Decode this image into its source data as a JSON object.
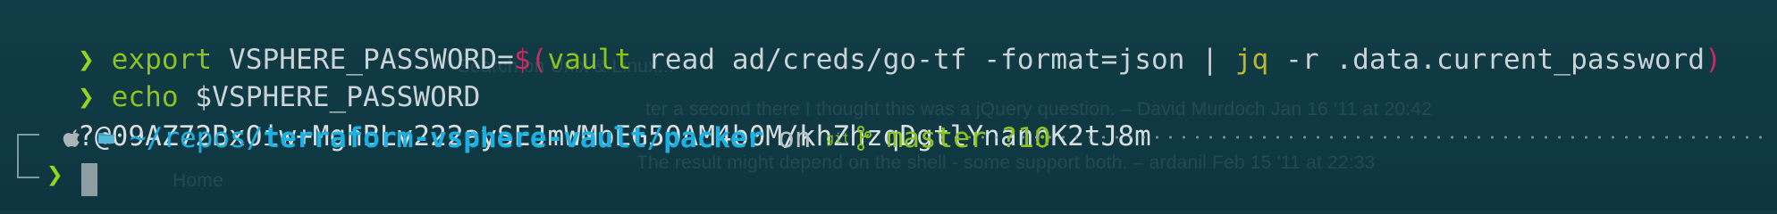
{
  "terminal": {
    "background_color": "#0f3b45",
    "line1": {
      "prompt": "❯",
      "command": "export",
      "arg1": " VSPHERE_PASSWORD=",
      "subst_open": "$(",
      "vault_cmd": "vault",
      "vault_args": " read ad/creds/go-tf -format=json ",
      "pipe": "| ",
      "jq_cmd": "jq",
      "jq_args": " -r .data.current_password",
      "subst_close": ")"
    },
    "line2": {
      "prompt": "❯",
      "command": "echo",
      "arg": " $VSPHERE_PASSWORD"
    },
    "line3": {
      "output": "?@09AZ72BxOiw+MghBLv222aySEJmWMbEG5OAM4b0M/khZhzqDgtlYnannK2tJ8m"
    },
    "status_bar": {
      "path_prefix": "~/repos/",
      "repo": "terraform-vsphere-vault",
      "separator": "/",
      "subdir": "packer",
      "on_word": "on",
      "git_label": "git",
      "branch": "master",
      "git_status": "?10",
      "apple_icon": "apple-icon",
      "folder_icon": "folder-icon",
      "git_icon": "git-icon",
      "branch_icon": "branch-icon"
    },
    "prompt": {
      "symbol": "❯"
    },
    "ghost_text": {
      "search": "Search on Unix & Linux...",
      "comment1": "ter a second there I thought this was a jQuery question. – David Murdoch Jan 16 '11 at 20:42",
      "comment2": "The result might depend on the shell - some support both. – ardanil Feb 15 '11 at 22:33",
      "home": "Home"
    }
  }
}
